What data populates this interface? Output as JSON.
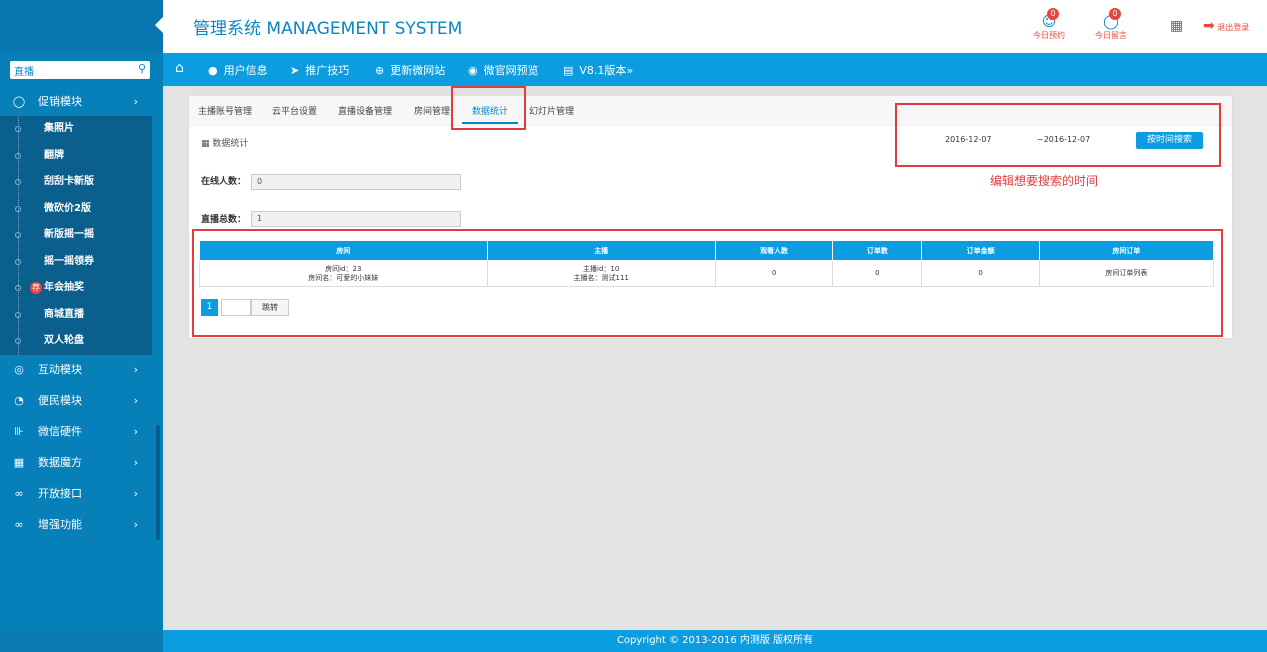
{
  "header": {
    "title": "管理系统 MANAGEMENT SYSTEM",
    "items": [
      {
        "label": "今日预约",
        "count": "0"
      },
      {
        "label": "今日留言",
        "count": "0"
      },
      {
        "label": ""
      },
      {
        "label": "退出登录"
      }
    ]
  },
  "search": {
    "value": "直播",
    "icon": "search-icon"
  },
  "sidebar": {
    "items": [
      {
        "label": "促销模块",
        "icon": "tag-icon"
      },
      {
        "label": "互动模块",
        "icon": "chart-icon"
      },
      {
        "label": "便民模块",
        "icon": "clock-icon"
      },
      {
        "label": "微信硬件",
        "icon": "wifi-icon"
      },
      {
        "label": "数据魔方",
        "icon": "grid-icon"
      },
      {
        "label": "开放接口",
        "icon": "link-icon"
      },
      {
        "label": "增强功能",
        "icon": "link-icon"
      }
    ],
    "sub": [
      "集照片",
      "翻牌",
      "刮刮卡新版",
      "微砍价2版",
      "新版摇一摇",
      "摇一摇领券",
      "年会抽奖",
      "商城直播",
      "双人轮盘"
    ],
    "badge": "荐"
  },
  "topnav": {
    "items": [
      "用户信息",
      "推广技巧",
      "更新微网站",
      "微官网预览",
      "V8.1版本"
    ]
  },
  "tabs": [
    "主播账号管理",
    "云平台设置",
    "直播设备管理",
    "房间管理",
    "数据统计",
    "幻灯片管理"
  ],
  "section_title": "数据统计",
  "form": {
    "online_label": "在线人数：",
    "online_value": "0",
    "total_label": "直播总数：",
    "total_value": "1"
  },
  "date": {
    "start": "2016-12-07",
    "end": "~2016-12-07",
    "button": "按时间搜索"
  },
  "note": "编辑想要搜索的时间",
  "table": {
    "headers": [
      "房间",
      "主播",
      "观看人数",
      "订单数",
      "订单金额",
      "房间订单"
    ],
    "rows": [
      [
        "房间id：23",
        "房间名：可爱的小妹妹",
        "主播id：10",
        "主播名：测试111",
        "0",
        "0",
        "0",
        "房间订单列表"
      ]
    ]
  },
  "pager": {
    "page": "1",
    "go": "跳转"
  },
  "footer": "Copyright © 2013-2016  内测版 版权所有"
}
